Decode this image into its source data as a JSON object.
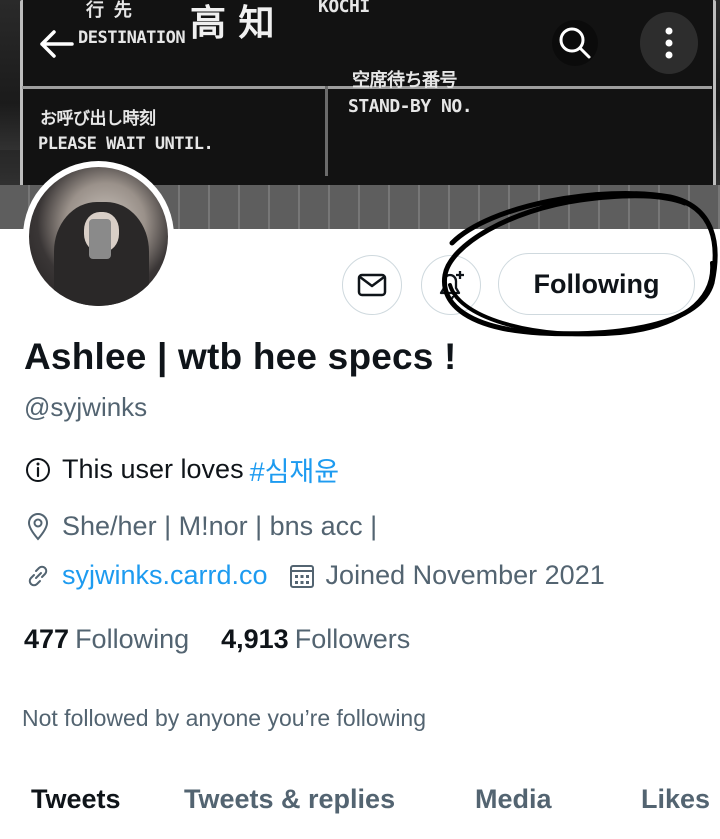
{
  "banner": {
    "sign_destination": "DESTINATION",
    "sign_city_jp": "高 知",
    "sign_city_en": "KOCHI",
    "sign_jp_top": "行 先",
    "sign_wait_jp": "お呼び出し時刻",
    "sign_wait_en": "PLEASE WAIT UNTIL.",
    "sign_standby_jp": "空席待ち番号",
    "sign_standby_en": "STAND-BY  NO."
  },
  "profile": {
    "display_name": "Ashlee | wtb hee specs !",
    "handle": "@syjwinks",
    "bio_prefix": "This user loves",
    "bio_hashtag": "#심재윤",
    "location": "She/her | M!nor | bns acc |",
    "website": "syjwinks.carrd.co",
    "joined": "Joined November 2021"
  },
  "actions": {
    "following_label": "Following"
  },
  "stats": {
    "following_count": "477",
    "following_label": "Following",
    "followers_count": "4,913",
    "followers_label": "Followers"
  },
  "social_context": "Not followed by anyone you’re following",
  "tabs": [
    {
      "label": "Tweets",
      "active": true
    },
    {
      "label": "Tweets & replies",
      "active": false
    },
    {
      "label": "Media",
      "active": false
    },
    {
      "label": "Likes",
      "active": false
    }
  ],
  "colors": {
    "accent": "#1d9bf0",
    "text_primary": "#0f1419",
    "text_secondary": "#536471",
    "border": "#cfd9de"
  },
  "icons": [
    "back-arrow-icon",
    "search-icon",
    "more-vertical-icon",
    "mail-icon",
    "bell-plus-icon",
    "info-icon",
    "location-icon",
    "link-icon",
    "calendar-icon"
  ]
}
